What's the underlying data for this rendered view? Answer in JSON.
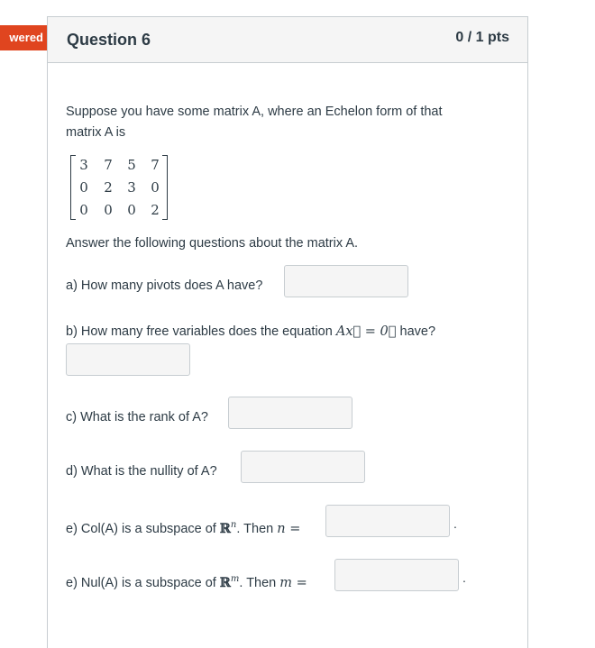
{
  "status_badge": "wered",
  "question": {
    "title": "Question 6",
    "points": "0 / 1 pts",
    "intro_1": "Suppose you have some matrix A, where an Echelon form of that",
    "intro_2": "matrix A is",
    "matrix": [
      [
        "3",
        "7",
        "5",
        "7"
      ],
      [
        "0",
        "2",
        "3",
        "0"
      ],
      [
        "0",
        "0",
        "0",
        "2"
      ]
    ],
    "instruction": "Answer the following questions about the matrix A.",
    "a": "a) How many pivots does A have?",
    "b_pre": "b) How many free variables does the equation ",
    "b_math": "Ax⃗ = 0⃗",
    "b_post": " have?",
    "c": "c) What is the rank of A?",
    "d": "d) What is the nullity of A?",
    "e1_pre": "e) Col(A) is a subspace of ",
    "e1_space": "ℝ",
    "e1_exp": "n",
    "e1_mid": ". Then ",
    "e1_var": "n =",
    "e2_pre": "e) Nul(A) is a subspace of ",
    "e2_space": "ℝ",
    "e2_exp": "m",
    "e2_mid": ". Then ",
    "e2_var": "m =",
    "period": "."
  }
}
